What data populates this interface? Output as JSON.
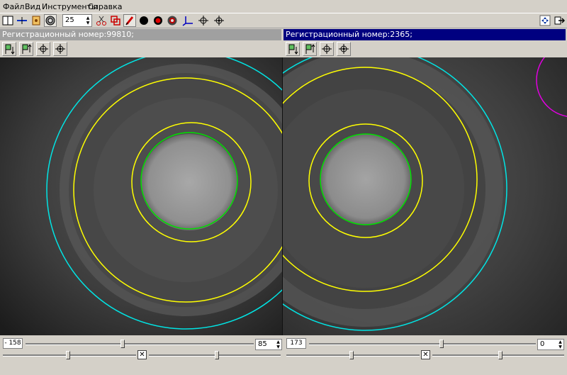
{
  "menu": [
    {
      "label": "Файл"
    },
    {
      "label": "Вид"
    },
    {
      "label": "Инструменты"
    },
    {
      "label": "Справка"
    }
  ],
  "toolbar": {
    "zoom_value": "25",
    "icons": [
      "split-view-icon",
      "crosshair-line-icon",
      "marker-icon",
      "target-icon",
      "scissors-icon",
      "overlay-icon",
      "pen-icon",
      "filled-circle-icon",
      "red-ring-icon",
      "ring-icon",
      "axes-icon",
      "crosshair-icon",
      "crosshair-dot-icon",
      "move-icon",
      "exit-icon"
    ]
  },
  "left_panel": {
    "header": "Регистрационный номер:99810;",
    "coord_label": "- 158",
    "slider_value": "85"
  },
  "right_panel": {
    "header": "Регистрационный номер:2365;",
    "coord_label": "173",
    "slider_value": "0"
  },
  "colors": {
    "active_header": "#000080",
    "inactive_header": "#a0a0a0",
    "outer_ring": "#00e5e5",
    "inner_rings": "#ffff00",
    "core_ring": "#00e000",
    "magenta_ring": "#e000e0"
  }
}
